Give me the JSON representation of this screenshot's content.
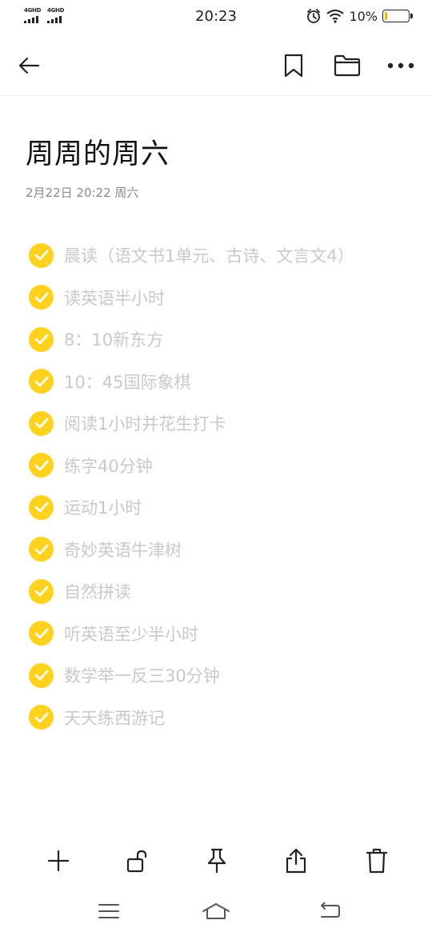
{
  "status_bar": {
    "signal_1": "4GHD",
    "signal_2": "4GHD",
    "time": "20:23",
    "battery_percent": "10%",
    "battery_level": 0.1,
    "icons": [
      "alarm-icon",
      "wifi-icon",
      "battery-icon"
    ]
  },
  "header": {
    "icons": [
      "back-arrow-icon",
      "bookmark-icon",
      "folder-icon",
      "more-icon"
    ]
  },
  "note": {
    "title": "周周的周六",
    "date": "2月22日 20:22 周六",
    "items": [
      "晨读（语文书1单元、古诗、文言文4）",
      "读英语半小时",
      "8：10新东方",
      "10：45国际象棋",
      "阅读1小时并花生打卡",
      "练字40分钟",
      "运动1小时",
      "奇妙英语牛津树",
      "自然拼读",
      "听英语至少半小时",
      "数学举一反三30分钟",
      "天天练西游记"
    ]
  },
  "bottom_toolbar": {
    "icons": [
      "add-icon",
      "unlock-icon",
      "pin-icon",
      "share-icon",
      "trash-icon"
    ]
  },
  "nav_bar": {
    "icons": [
      "menu-icon",
      "home-icon",
      "back-icon"
    ]
  },
  "colors": {
    "accent": "#ffd21f",
    "done_text": "#c9c9c9",
    "date_text": "#8a8a8a"
  }
}
